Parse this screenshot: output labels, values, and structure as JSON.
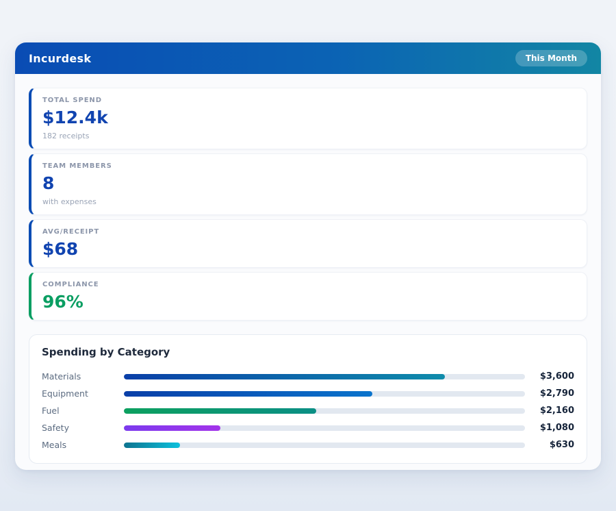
{
  "header": {
    "title": "Incurdesk",
    "badge": "This Month"
  },
  "stats": [
    {
      "label": "TOTAL SPEND",
      "value": "$12.4k",
      "sub": "182 receipts",
      "accent_color": "#0a4cb4",
      "value_color": "#1144b0"
    },
    {
      "label": "TEAM MEMBERS",
      "value": "8",
      "sub": "with expenses",
      "accent_color": "#0a4cb4",
      "value_color": "#1144b0"
    },
    {
      "label": "AVG/RECEIPT",
      "value": "$68",
      "sub": "",
      "accent_color": "#0a4cb4",
      "value_color": "#1144b0"
    },
    {
      "label": "COMPLIANCE",
      "value": "96%",
      "sub": "",
      "accent_color": "#0a9e62",
      "value_color": "#0a9e62"
    }
  ],
  "chart_data": {
    "type": "bar",
    "orientation": "horizontal",
    "title": "Spending by Category",
    "categories": [
      "Materials",
      "Equipment",
      "Fuel",
      "Safety",
      "Meals"
    ],
    "values": [
      3600,
      2790,
      2160,
      1080,
      630
    ],
    "value_labels": [
      "$3,600",
      "$2,790",
      "$2,160",
      "$1,080",
      "$630"
    ],
    "scale_max": 4500,
    "track_color": "#e2e8f0",
    "bar_colors": [
      [
        "#0a3fa8",
        "#0f8cab"
      ],
      [
        "#0a3fa8",
        "#0b74cc"
      ],
      [
        "#0ca05f",
        "#0b8f85"
      ],
      [
        "#7c3aed",
        "#a234ea"
      ],
      [
        "#0e7490",
        "#0cc0dc"
      ]
    ],
    "grid": false,
    "legend": false
  }
}
